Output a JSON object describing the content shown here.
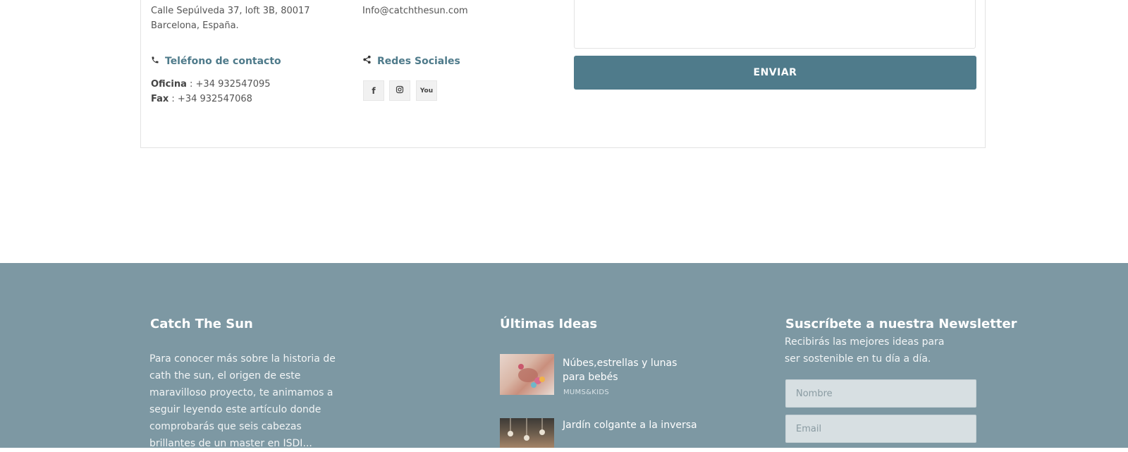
{
  "contact": {
    "address_line1": "Calle Sepúlveda 37, loft 3B, 80017",
    "address_line2": "Barcelona, España.",
    "email": "Info@catchthesun.com",
    "phone_heading": "Teléfono de contacto",
    "office_label": "Oficina",
    "office_value": " : +34 932547095",
    "fax_label": "Fax",
    "fax_value": " : +34 932547068",
    "social_heading": "Redes Sociales",
    "social_icons": [
      "facebook-icon",
      "instagram-icon",
      "youtube-icon"
    ]
  },
  "form": {
    "send_label": "ENVIAR"
  },
  "footer": {
    "about": {
      "title": "Catch The Sun",
      "text": "Para conocer más sobre la historia de cath the sun, el origen de este maravilloso proyecto, te animamos a seguir leyendo este artículo donde comprobarás que seis cabezas brillantes de un master en ISDI..."
    },
    "ideas": {
      "title": "Últimas Ideas",
      "posts": [
        {
          "title": "Núbes,estrellas y lunas para bebés",
          "category": "MUMS&KIDS"
        },
        {
          "title": "Jardín colgante a la inversa",
          "category": ""
        }
      ]
    },
    "newsletter": {
      "title": "Suscríbete a nuestra Newsletter",
      "text": "Recibirás las mejores ideas para ser sostenible en tu día a día.",
      "name_placeholder": "Nombre",
      "email_placeholder": "Email"
    }
  },
  "colors": {
    "accent": "#4f7b8b",
    "footer_bg": "#7d98a3",
    "input_bg": "#d7dfe2"
  }
}
